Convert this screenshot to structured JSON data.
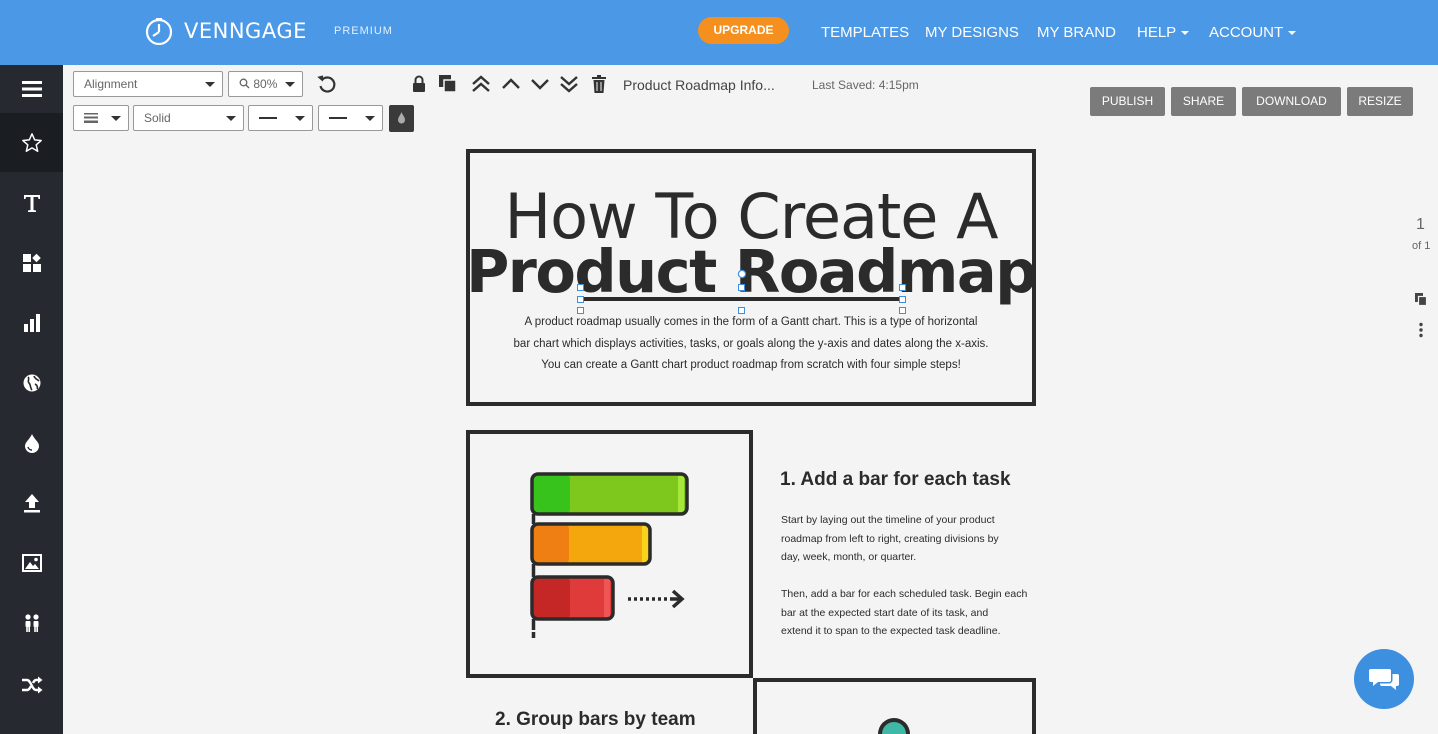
{
  "brand": {
    "name": "VENNGAGE",
    "tier": "PREMIUM"
  },
  "topnav": {
    "upgrade": "UPGRADE",
    "templates": "TEMPLATES",
    "my_designs": "MY DESIGNS",
    "my_brand": "MY BRAND",
    "help": "HELP",
    "account": "ACCOUNT"
  },
  "sidebar": {
    "items": [
      "menu-icon",
      "star-icon",
      "text-icon",
      "widgets-icon",
      "chart-icon",
      "globe-icon",
      "fill-icon",
      "upload-icon",
      "image-icon",
      "people-icon",
      "shuffle-icon"
    ]
  },
  "toolbar": {
    "alignment": "Alignment",
    "zoom": "80%",
    "line_style": "Solid",
    "document_title": "Product Roadmap Info...",
    "last_saved": "Last Saved: 4:15pm",
    "publish": "PUBLISH",
    "share": "SHARE",
    "download": "DOWNLOAD",
    "resize": "RESIZE"
  },
  "canvas": {
    "title_line1": "How To Create A",
    "title_line2": "Product Roadmap",
    "intro_line1": "A product roadmap usually comes in the form of a Gantt chart. This is a type of horizontal",
    "intro_line2": "bar chart which displays activities, tasks, or goals along the y-axis and dates along the x-axis.",
    "intro_line3": "You can create a Gantt chart product roadmap from scratch with four simple steps!",
    "step1_title": "1. Add a bar for each task",
    "step1_p1_l1": "Start by laying out the timeline of your product",
    "step1_p1_l2": "roadmap from left to right, creating divisions by",
    "step1_p1_l3": "day, week, month, or quarter.",
    "step1_p2_l1": "Then, add a bar for each scheduled task. Begin each",
    "step1_p2_l2": "bar at the expected start date of its task, and",
    "step1_p2_l3": "extend it to span to the expected task deadline.",
    "step2_title": "2. Group bars by team"
  },
  "pager": {
    "page": "1",
    "of": "of 1"
  },
  "colors": {
    "topbar": "#4a98e6",
    "upgrade": "#f5901e",
    "sidebar": "#262a30",
    "accent": "#3d8fe0"
  }
}
